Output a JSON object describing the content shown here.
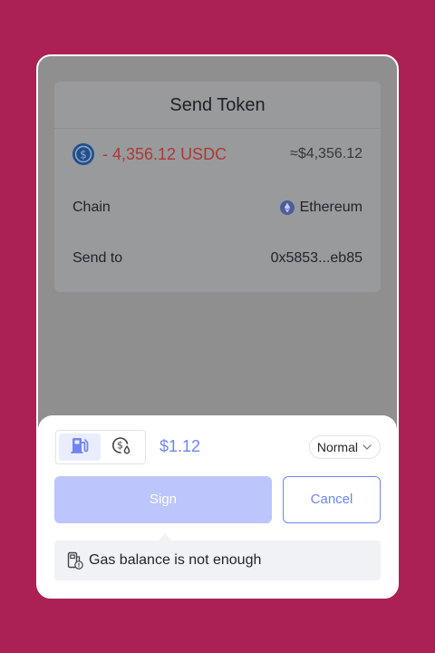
{
  "header": {
    "title": "Send Token"
  },
  "transaction": {
    "amount": "- 4,356.12 USDC",
    "fiat": "≈$4,356.12",
    "token_icon": "usdc-icon",
    "chain_label": "Chain",
    "chain_value": "Ethereum",
    "chain_icon": "ethereum-icon",
    "send_to_label": "Send to",
    "send_to_value": "0x5853...eb85"
  },
  "gas": {
    "options": [
      "gas-pump-icon",
      "dollar-drop-icon"
    ],
    "selected": "gas-pump-icon",
    "price": "$1.12",
    "speed": "Normal"
  },
  "actions": {
    "sign_label": "Sign",
    "cancel_label": "Cancel"
  },
  "warning": {
    "text": "Gas balance is not enough",
    "icon": "gas-warning-icon"
  },
  "colors": {
    "background": "#ab2155",
    "accent": "#7184f4",
    "sign_disabled": "#bcc5fc",
    "amount_negative": "#a93a37",
    "overlay": "#8f8f90"
  }
}
